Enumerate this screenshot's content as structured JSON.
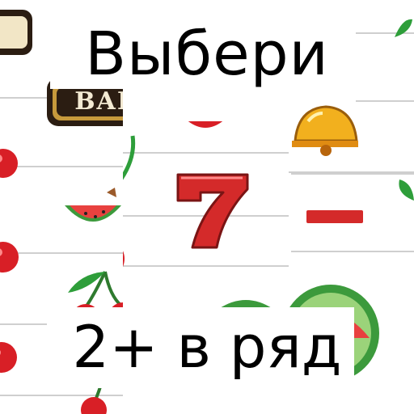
{
  "header": {
    "title": "Выбери"
  },
  "footer": {
    "subtitle": "2+ в ряд"
  },
  "symbols": {
    "bar_label": "BAR",
    "seven_label": "7"
  },
  "icons": [
    "cherry-icon",
    "bar-icon",
    "seven-icon",
    "watermelon-icon",
    "bell-icon",
    "lemon-icon"
  ],
  "colors": {
    "cherry_red": "#d81f26",
    "leaf_green": "#2e9e3a",
    "seven_red": "#d42a2a",
    "bar_dark": "#2b1d12",
    "bell_gold": "#f2b01e",
    "melon_rind": "#3c9a3c",
    "melon_flesh": "#e8413f"
  }
}
